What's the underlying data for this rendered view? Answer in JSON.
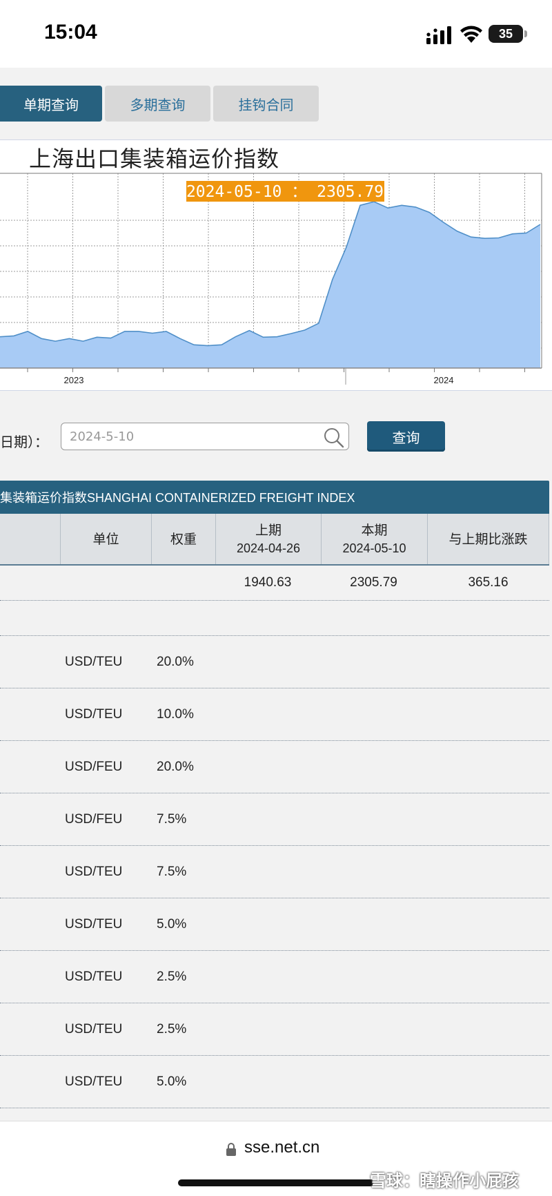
{
  "status_bar": {
    "time": "15:04",
    "battery": "35"
  },
  "tabs": [
    {
      "label": "单期查询",
      "active": true
    },
    {
      "label": "多期查询",
      "active": false
    },
    {
      "label": "挂钩合同",
      "active": false
    }
  ],
  "chart": {
    "title": "上海出口集装箱运价指数",
    "tooltip": "2024-05-10 ： 2305.79",
    "x_labels": [
      "2023",
      "2024"
    ],
    "fill_color": "#a8cbf5",
    "line_color": "#4f8fc8",
    "tooltip_color": "#f0960e"
  },
  "chart_data": {
    "type": "area",
    "title": "上海出口集装箱运价指数",
    "x_tick_labels": [
      "2023",
      "2024"
    ],
    "series": [
      {
        "values": [
          1050,
          1060,
          1110,
          1030,
          1000,
          1030,
          1000,
          1045,
          1035,
          1110,
          1110,
          1090,
          1110,
          1030,
          960,
          950,
          960,
          1050,
          1120,
          1045,
          1050,
          1085,
          1125,
          1200,
          1690,
          2050,
          2520,
          2560,
          2490,
          2520,
          2500,
          2440,
          2330,
          2230,
          2165,
          2150,
          2155,
          2200,
          2210,
          2305.79
        ]
      }
    ],
    "annotation": "2024-05-10 ： 2305.79",
    "grid": true
  },
  "query": {
    "date_label": "日期）：",
    "date_value": "2024-5-10",
    "button_label": "查询"
  },
  "table": {
    "title": "集装箱运价指数SHANGHAI CONTAINERIZED FREIGHT INDEX",
    "headers": {
      "unit": "单位",
      "weight": "权重",
      "prev": "上期",
      "prev_date": "2024-04-26",
      "curr": "本期",
      "curr_date": "2024-05-10",
      "change": "与上期比涨跌"
    },
    "composite": {
      "prev": "1940.63",
      "curr": "2305.79",
      "change": "365.16"
    },
    "rows": [
      {
        "unit": "USD/TEU",
        "weight": "20.0%"
      },
      {
        "unit": "USD/TEU",
        "weight": "10.0%"
      },
      {
        "unit": "USD/FEU",
        "weight": "20.0%"
      },
      {
        "unit": "USD/FEU",
        "weight": "7.5%"
      },
      {
        "unit": "USD/TEU",
        "weight": "7.5%"
      },
      {
        "unit": "USD/TEU",
        "weight": "5.0%"
      },
      {
        "unit": "USD/TEU",
        "weight": "2.5%"
      },
      {
        "unit": "USD/TEU",
        "weight": "2.5%"
      },
      {
        "unit": "USD/TEU",
        "weight": "5.0%"
      }
    ]
  },
  "address_bar": {
    "url": "sse.net.cn"
  },
  "watermark": "雪球：瞎操作小屁孩"
}
